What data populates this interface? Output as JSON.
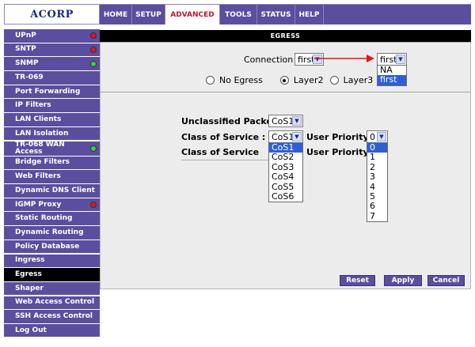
{
  "brand": {
    "logo_text": "ACORP"
  },
  "topnav": [
    {
      "label": "HOME",
      "active": false
    },
    {
      "label": "SETUP",
      "active": false
    },
    {
      "label": "ADVANCED",
      "active": true
    },
    {
      "label": "TOOLS",
      "active": false
    },
    {
      "label": "STATUS",
      "active": false
    },
    {
      "label": "HELP",
      "active": false
    }
  ],
  "sidebar": {
    "items": [
      {
        "label": "UPnP",
        "status": "red"
      },
      {
        "label": "SNTP",
        "status": "red"
      },
      {
        "label": "SNMP",
        "status": "green"
      },
      {
        "label": "TR-069",
        "status": ""
      },
      {
        "label": "Port Forwarding",
        "status": ""
      },
      {
        "label": "IP Filters",
        "status": ""
      },
      {
        "label": "LAN Clients",
        "status": ""
      },
      {
        "label": "LAN Isolation",
        "status": ""
      },
      {
        "label": "TR-068 WAN Access",
        "status": "green"
      },
      {
        "label": "Bridge Filters",
        "status": ""
      },
      {
        "label": "Web Filters",
        "status": ""
      },
      {
        "label": "Dynamic DNS Client",
        "status": ""
      },
      {
        "label": "IGMP Proxy",
        "status": "red"
      },
      {
        "label": "Static Routing",
        "status": ""
      },
      {
        "label": "Dynamic Routing",
        "status": ""
      },
      {
        "label": "Policy Database",
        "status": ""
      },
      {
        "label": "Ingress",
        "status": ""
      },
      {
        "label": "Egress",
        "status": "",
        "active": true
      },
      {
        "label": "Shaper",
        "status": ""
      },
      {
        "label": "Web Access Control",
        "status": ""
      },
      {
        "label": "SSH Access Control",
        "status": ""
      },
      {
        "label": "Log Out",
        "status": ""
      }
    ]
  },
  "main": {
    "title": "EGRESS",
    "connection": {
      "label": "Connection :",
      "value_left": "first",
      "value_right": "first",
      "options": [
        "NA",
        "first"
      ],
      "selected_option": "first"
    },
    "mode": {
      "options": [
        "No Egress",
        "Layer2",
        "Layer3"
      ],
      "selected": "Layer2"
    },
    "unclassified_label": "Unclassified Packet :",
    "unclassified_value": "CoS1",
    "class_of_service_label": "Class of Service :",
    "class_of_service_value": "CoS1",
    "class_of_service_header": "Class of Service",
    "user_priority_label": "User Priority :",
    "user_priority_header": "User Priority",
    "user_priority_value": "0",
    "cos_options": [
      "CoS1",
      "CoS2",
      "CoS3",
      "CoS4",
      "CoS5",
      "CoS6"
    ],
    "priority_options": [
      "0",
      "1",
      "2",
      "3",
      "4",
      "5",
      "6",
      "7"
    ]
  },
  "buttons": {
    "reset": "Reset",
    "apply": "Apply",
    "cancel": "Cancel"
  },
  "colors": {
    "nav_bg": "#5b4e9e",
    "active_tab_text": "#c8142a",
    "selection": "#2f5fd8",
    "arrow": "#e0141e"
  }
}
